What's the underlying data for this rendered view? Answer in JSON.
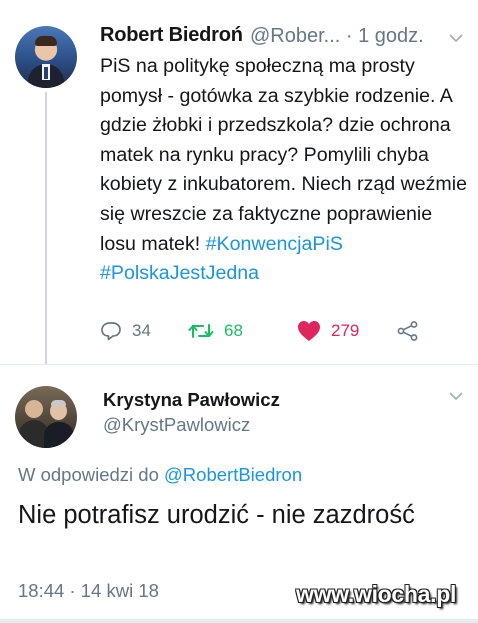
{
  "tweet": {
    "author_name": "Robert Biedroń",
    "author_handle": "@Rober...",
    "time_separator": " · ",
    "time": "1 godz.",
    "text_plain": "PiS na politykę społeczną ma prosty pomysł - gotówka za szybkie rodzenie. A gdzie żłobki i przedszkola? dzie ochrona matek na rynku pracy? Pomylili chyba kobiety z inkubatorem. Niech rząd weźmie się wreszcie za faktyczne poprawienie losu matek!",
    "hashtag1": "#KonwencjaPiS",
    "hashtag2": "#PolskaJestJedna",
    "reply_count": "34",
    "retweet_count": "68",
    "like_count": "279"
  },
  "reply": {
    "author_name": "Krystyna Pawłowicz",
    "author_handle": "@KrystPawlowicz",
    "replying_prefix": "W odpowiedzi do ",
    "replying_to": "@RobertBiedron",
    "text": "Nie potrafisz urodzić - nie zazdrość",
    "timestamp": "18:44 · 14 kwi 18"
  },
  "watermark": "www.wiocha.pl",
  "icons": {
    "reply": "reply-icon",
    "retweet": "retweet-icon",
    "like": "heart-icon",
    "share": "share-icon",
    "menu": "chevron-down-icon"
  },
  "colors": {
    "link": "#1b95e0",
    "retweet": "#17bf63",
    "like": "#e0245e",
    "secondary": "#657786"
  }
}
